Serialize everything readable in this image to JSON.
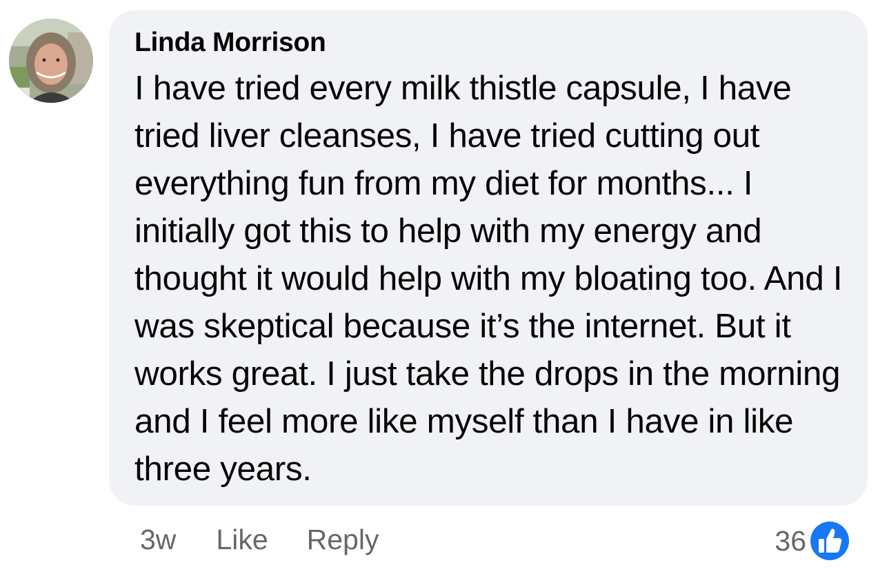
{
  "comment": {
    "author": "Linda Morrison",
    "text": "I have tried every milk thistle capsule, I have tried liver cleanses, I have tried cutting out everything fun from my diet for months... I initially got this to help with my energy and thought it would help with my bloating too. And I was skeptical because it’s the internet. But it works great. I just take the drops in the morning and I feel more like myself than I have in like three years.",
    "time": "3w",
    "like_label": "Like",
    "reply_label": "Reply",
    "reaction_count": "36",
    "reaction_icon": "thumbs-up-icon"
  },
  "colors": {
    "bubble_bg": "#f0f2f5",
    "text": "#050505",
    "meta": "#65676b",
    "like_blue": "#1877f2"
  }
}
